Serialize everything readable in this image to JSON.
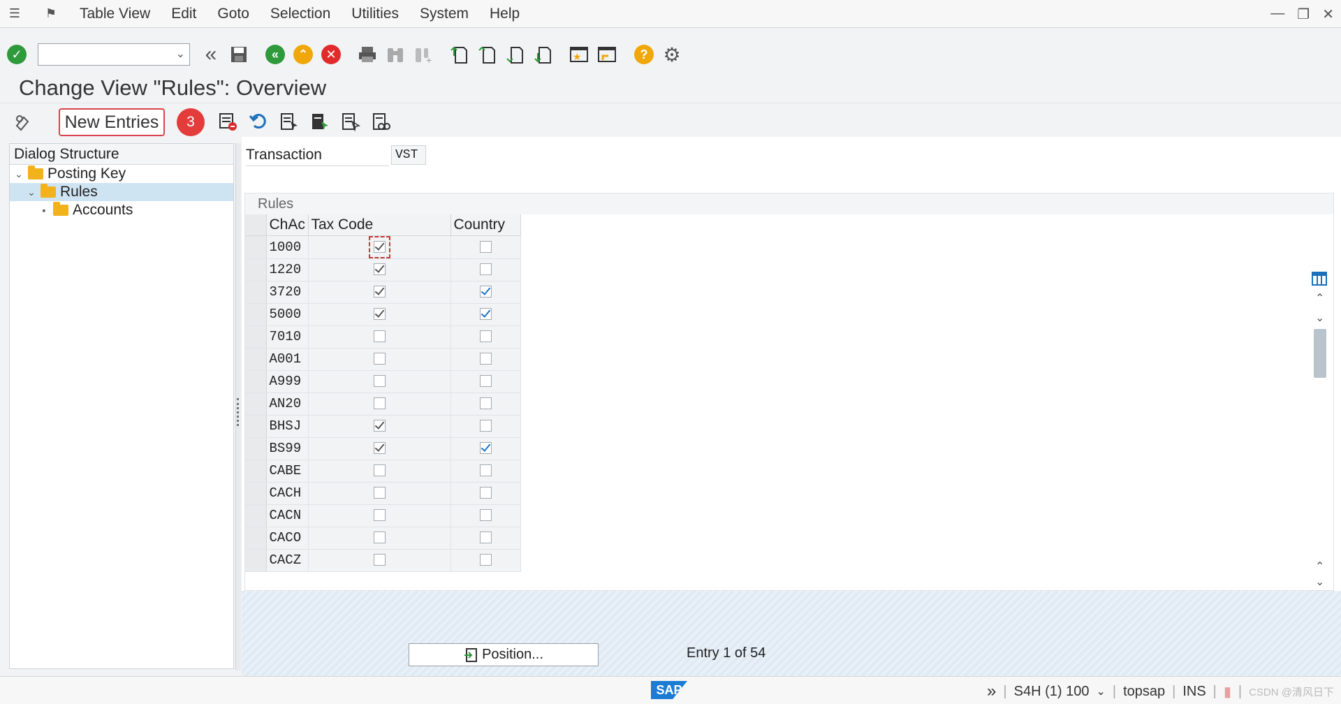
{
  "menubar": {
    "items": [
      "Table View",
      "Edit",
      "Goto",
      "Selection",
      "Utilities",
      "System",
      "Help"
    ]
  },
  "toolbar": {
    "command_field_value": ""
  },
  "page": {
    "title": "Change View \"Rules\": Overview"
  },
  "app_toolbar": {
    "new_entries_label": "New Entries",
    "step_badge": "3"
  },
  "dialog_structure": {
    "header": "Dialog Structure",
    "nodes": [
      {
        "label": "Posting Key",
        "level": 1,
        "expanded": true,
        "selected": false
      },
      {
        "label": "Rules",
        "level": 2,
        "expanded": true,
        "selected": true
      },
      {
        "label": "Accounts",
        "level": 3,
        "expanded": false,
        "selected": false
      }
    ]
  },
  "header_fields": {
    "transaction_label": "Transaction",
    "transaction_value": "VST"
  },
  "rules_table": {
    "title": "Rules",
    "columns": [
      "ChAc",
      "Tax Code",
      "Country"
    ],
    "rows": [
      {
        "chac": "1000",
        "tax_code": true,
        "country": false
      },
      {
        "chac": "1220",
        "tax_code": true,
        "country": false
      },
      {
        "chac": "3720",
        "tax_code": true,
        "country": true
      },
      {
        "chac": "5000",
        "tax_code": true,
        "country": true
      },
      {
        "chac": "7010",
        "tax_code": false,
        "country": false
      },
      {
        "chac": "A001",
        "tax_code": false,
        "country": false
      },
      {
        "chac": "A999",
        "tax_code": false,
        "country": false
      },
      {
        "chac": "AN20",
        "tax_code": false,
        "country": false
      },
      {
        "chac": "BHSJ",
        "tax_code": true,
        "country": false
      },
      {
        "chac": "BS99",
        "tax_code": true,
        "country": true
      },
      {
        "chac": "CABE",
        "tax_code": false,
        "country": false
      },
      {
        "chac": "CACH",
        "tax_code": false,
        "country": false
      },
      {
        "chac": "CACN",
        "tax_code": false,
        "country": false
      },
      {
        "chac": "CACO",
        "tax_code": false,
        "country": false
      },
      {
        "chac": "CACZ",
        "tax_code": false,
        "country": false
      }
    ]
  },
  "footer": {
    "position_button_label": "Position...",
    "entry_info": "Entry 1 of 54"
  },
  "statusbar": {
    "sap_logo": "SAP",
    "system": "S4H (1) 100",
    "user": "topsap",
    "mode": "INS",
    "watermark": "CSDN @清风日下"
  },
  "colors": {
    "accent_red": "#e43b3b",
    "selection_blue": "#cfe4f3",
    "sap_blue": "#1c7bd3"
  }
}
